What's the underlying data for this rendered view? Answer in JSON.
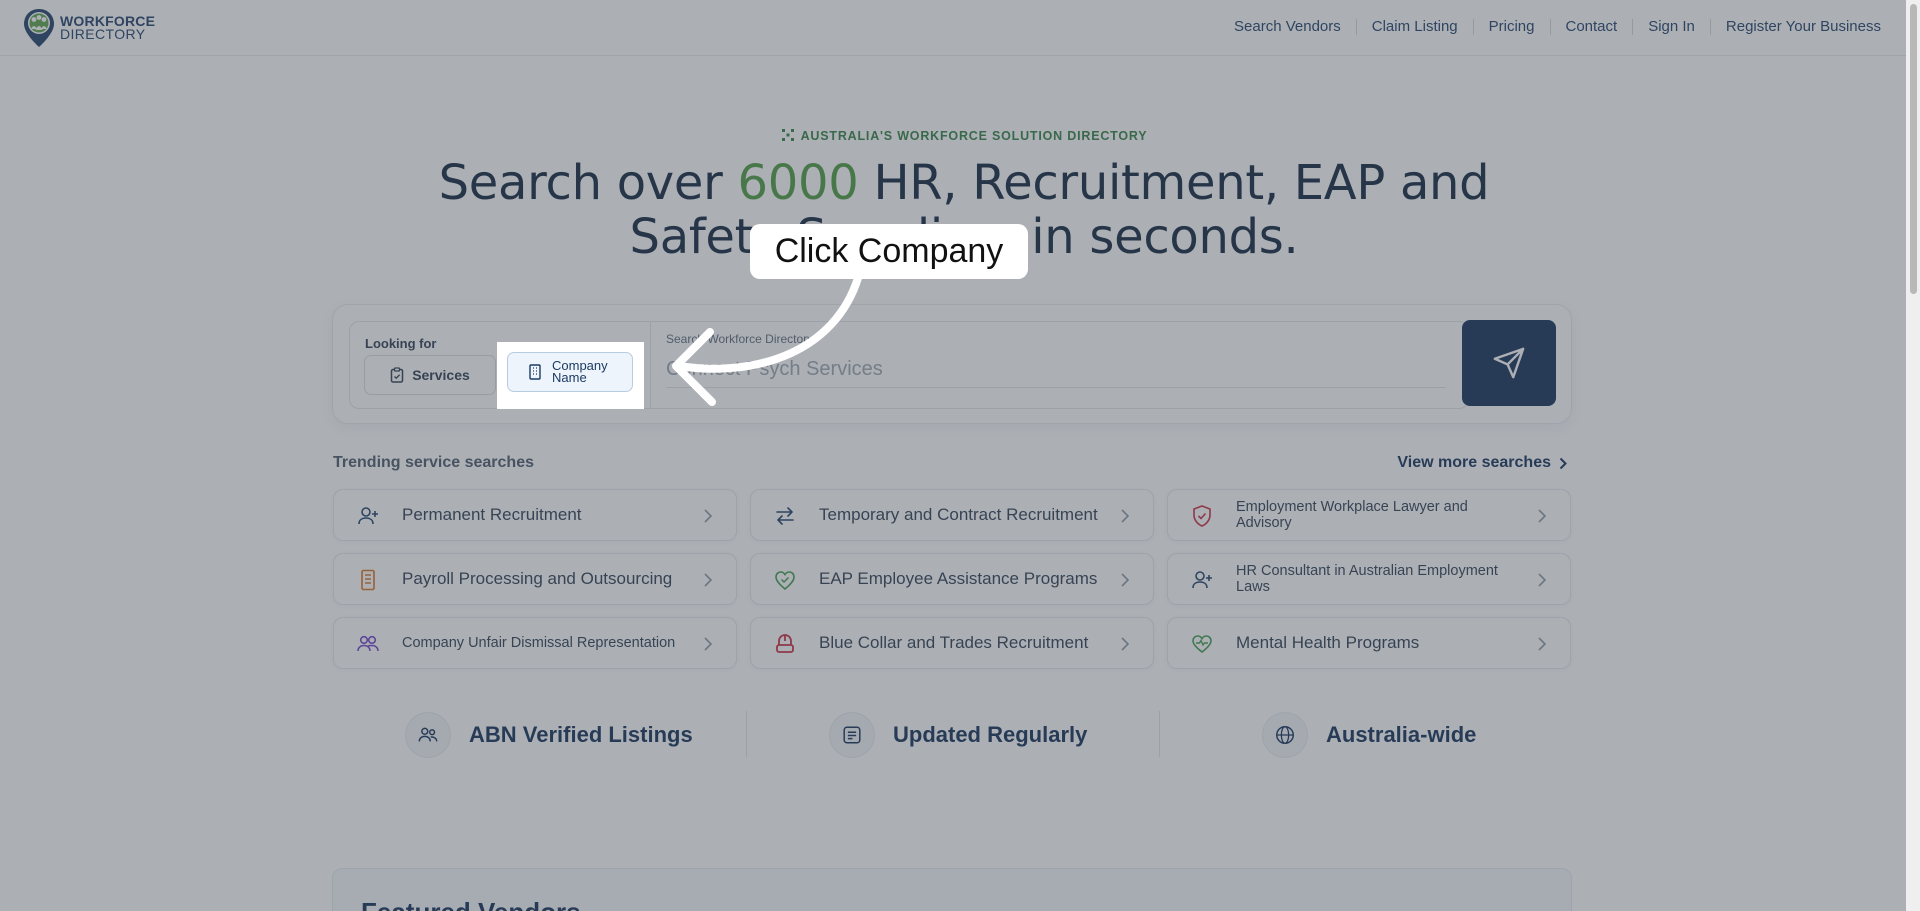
{
  "header": {
    "logo_line1": "WORKFORCE",
    "logo_line2": "DIRECTORY",
    "nav": [
      "Search Vendors",
      "Claim Listing",
      "Pricing",
      "Contact",
      "Sign In",
      "Register Your Business"
    ]
  },
  "hero": {
    "eyebrow": "AUSTRALIA'S WORKFORCE SOLUTION DIRECTORY",
    "headline_pre": "Search over ",
    "headline_num": "6000",
    "headline_post": " HR, Recruitment, EAP and",
    "headline_line2": "Safety Suppliers in seconds."
  },
  "search": {
    "looking_for": "Looking for",
    "services_label": "Services",
    "company_line1": "Company",
    "company_line2": "Name",
    "field_label": "Search Workforce Directory",
    "placeholder": "Connect Psych Services"
  },
  "trending": {
    "title": "Trending service searches",
    "view_more": "View more searches",
    "items": [
      {
        "label": "Permanent Recruitment",
        "icon": "user-plus-icon"
      },
      {
        "label": "Temporary and Contract Recruitment",
        "icon": "arrows-swap-icon"
      },
      {
        "label": "Employment Workplace Lawyer and Advisory",
        "icon": "shield-icon"
      },
      {
        "label": "Payroll Processing and Outsourcing",
        "icon": "document-icon"
      },
      {
        "label": "EAP Employee Assistance Programs",
        "icon": "heart-shield-icon"
      },
      {
        "label": "HR Consultant in Australian Employment Laws",
        "icon": "user-plus-icon"
      },
      {
        "label": "Company Unfair Dismissal Representation",
        "icon": "users-icon"
      },
      {
        "label": "Blue Collar and Trades Recruitment",
        "icon": "hardhat-icon"
      },
      {
        "label": "Mental Health Programs",
        "icon": "heart-icon"
      }
    ]
  },
  "features": [
    "ABN Verified Listings",
    "Updated Regularly",
    "Australia-wide"
  ],
  "featured_title": "Featured Vendors",
  "callout": "Click Company",
  "colors": {
    "navy": "#0d2a55",
    "green": "#4a9a3c",
    "eyebrow_green": "#2f7d3f"
  }
}
